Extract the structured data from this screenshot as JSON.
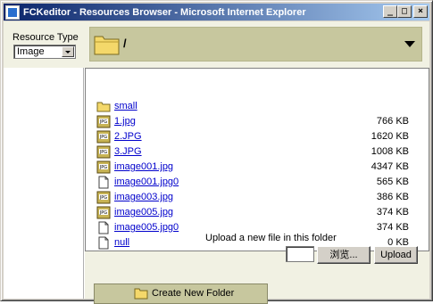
{
  "window": {
    "title": "FCKeditor - Resources Browser - Microsoft Internet Explorer",
    "minimize_glyph": "_",
    "maximize_glyph": "□",
    "close_glyph": "×"
  },
  "header": {
    "resource_type_label": "Resource Type",
    "resource_type_value": "Image",
    "current_folder": "/"
  },
  "files": [
    {
      "name": "small",
      "size": "",
      "icon": "folder-icon"
    },
    {
      "name": "1.jpg",
      "size": "766 KB",
      "icon": "jpg-file-icon"
    },
    {
      "name": "2.JPG",
      "size": "1620 KB",
      "icon": "jpg-file-icon"
    },
    {
      "name": "3.JPG",
      "size": "1008 KB",
      "icon": "jpg-file-icon"
    },
    {
      "name": "image001.jpg",
      "size": "4347 KB",
      "icon": "jpg-file-icon"
    },
    {
      "name": "image001.jpg0",
      "size": "565 KB",
      "icon": "generic-file-icon"
    },
    {
      "name": "image003.jpg",
      "size": "386 KB",
      "icon": "jpg-file-icon"
    },
    {
      "name": "image005.jpg",
      "size": "374 KB",
      "icon": "jpg-file-icon"
    },
    {
      "name": "image005.jpg0",
      "size": "374 KB",
      "icon": "generic-file-icon"
    },
    {
      "name": "null",
      "size": "0 KB",
      "icon": "generic-file-icon"
    }
  ],
  "footer": {
    "create_folder_label": "Create New Folder",
    "upload_label": "Upload a new file in this folder",
    "browse_label": "浏览...",
    "upload_button": "Upload"
  },
  "colors": {
    "title_start": "#0a246a",
    "title_end": "#a6caf0",
    "header_bg": "#f1f1e3",
    "accent_olive": "#c7c79e",
    "link": "#0000cc"
  }
}
